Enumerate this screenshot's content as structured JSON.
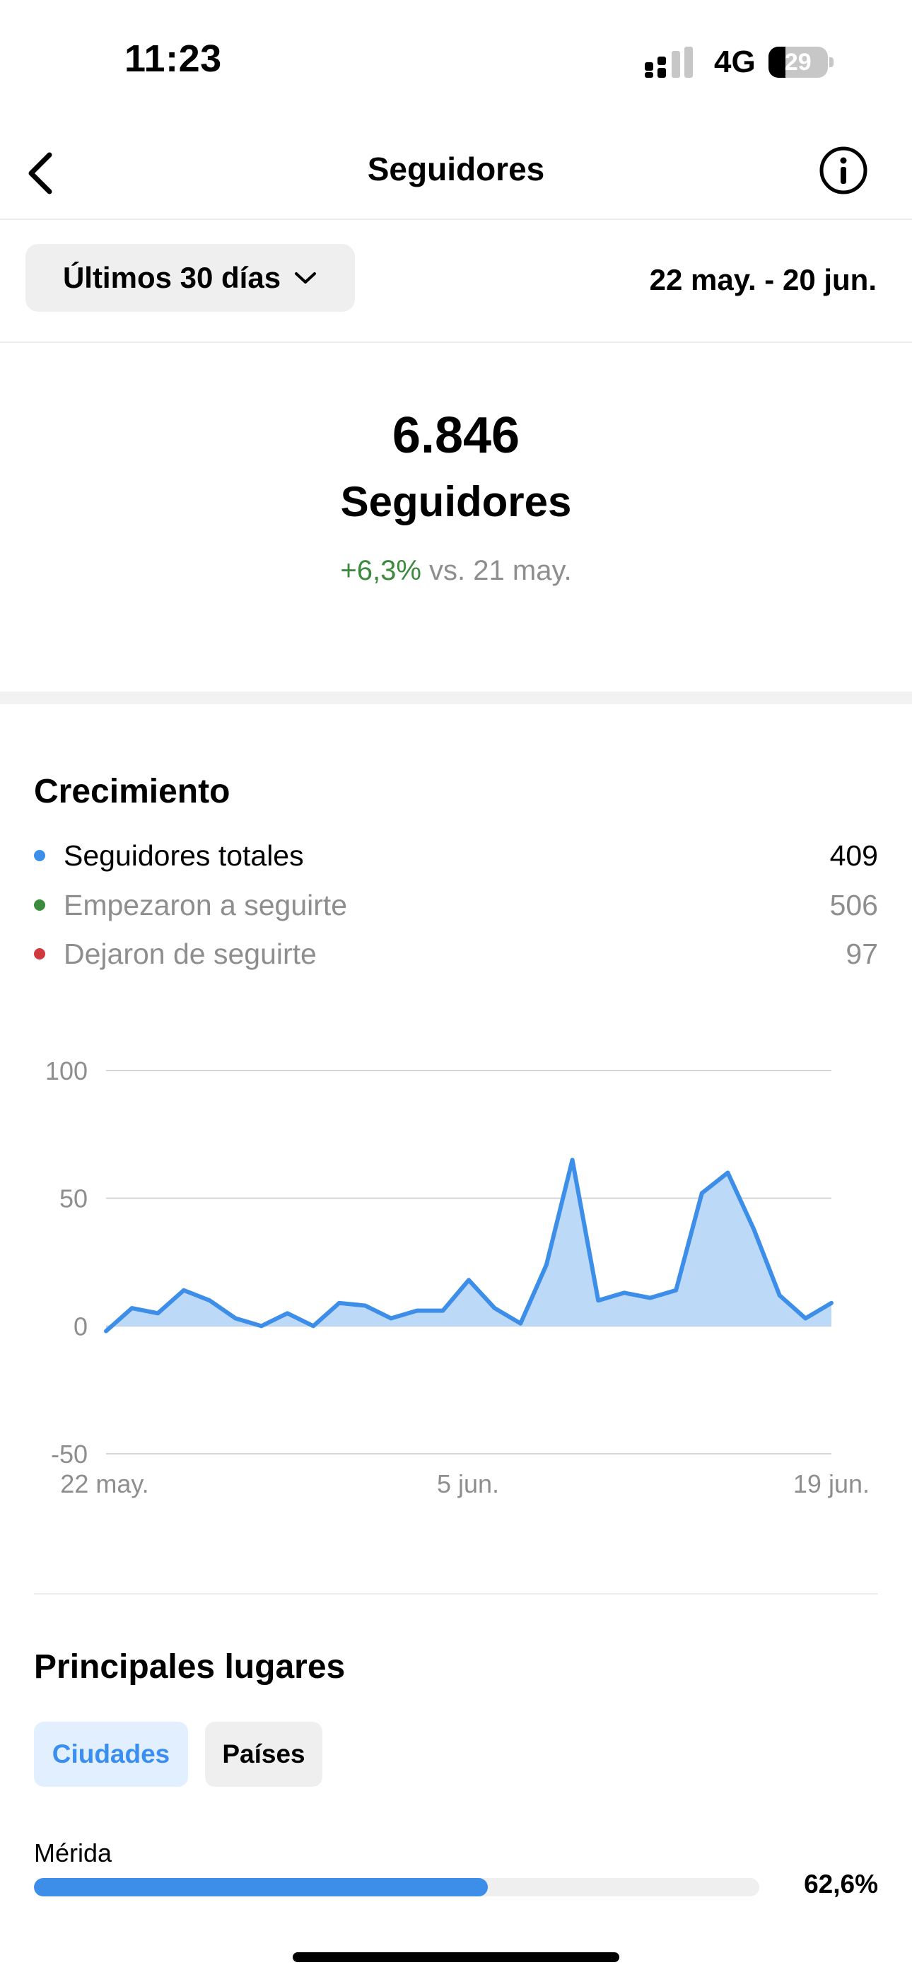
{
  "status_bar": {
    "time": "11:23",
    "network": "4G",
    "battery_level": "29",
    "battery_fraction": 0.29
  },
  "nav": {
    "title": "Seguidores",
    "back_icon": "chevron-left-icon",
    "info_icon": "info-icon"
  },
  "filters": {
    "period_label": "Últimos 30 días",
    "date_range": "22 may. - 20 jun."
  },
  "summary": {
    "value": "6.846",
    "label": "Seguidores",
    "change": "+6,3%",
    "change_suffix": " vs. 21 may."
  },
  "growth": {
    "title": "Crecimiento",
    "legend": [
      {
        "label": "Seguidores totales",
        "value": "409",
        "color": "#3d8ee8",
        "text_color": "#000000"
      },
      {
        "label": "Empezaron a seguirte",
        "value": "506",
        "color": "#3b8a3e",
        "text_color": "#8e8e8e"
      },
      {
        "label": "Dejaron de seguirte",
        "value": "97",
        "color": "#d0393e",
        "text_color": "#8e8e8e"
      }
    ]
  },
  "chart_data": {
    "type": "area",
    "y_ticks": [
      "100",
      "50",
      "0",
      "-50"
    ],
    "ylim": [
      -50,
      100
    ],
    "x_tick_labels": [
      "22 may.",
      "5 jun.",
      "19 jun."
    ],
    "series": [
      {
        "values": [
          -2,
          7,
          5,
          14,
          10,
          3,
          0,
          5,
          0,
          9,
          8,
          3,
          6,
          6,
          18,
          7,
          1,
          24,
          65,
          10,
          13,
          11,
          14,
          52,
          60,
          38,
          12,
          3,
          9
        ],
        "color": "#3d8ee8",
        "fill": "#bcdaf8"
      }
    ],
    "grid": true
  },
  "places": {
    "title": "Principales lugares",
    "tabs": [
      {
        "label": "Ciudades",
        "active": true
      },
      {
        "label": "Países",
        "active": false
      }
    ],
    "items": [
      {
        "name": "Mérida",
        "percent": "62,6%",
        "fraction": 0.626
      }
    ]
  }
}
